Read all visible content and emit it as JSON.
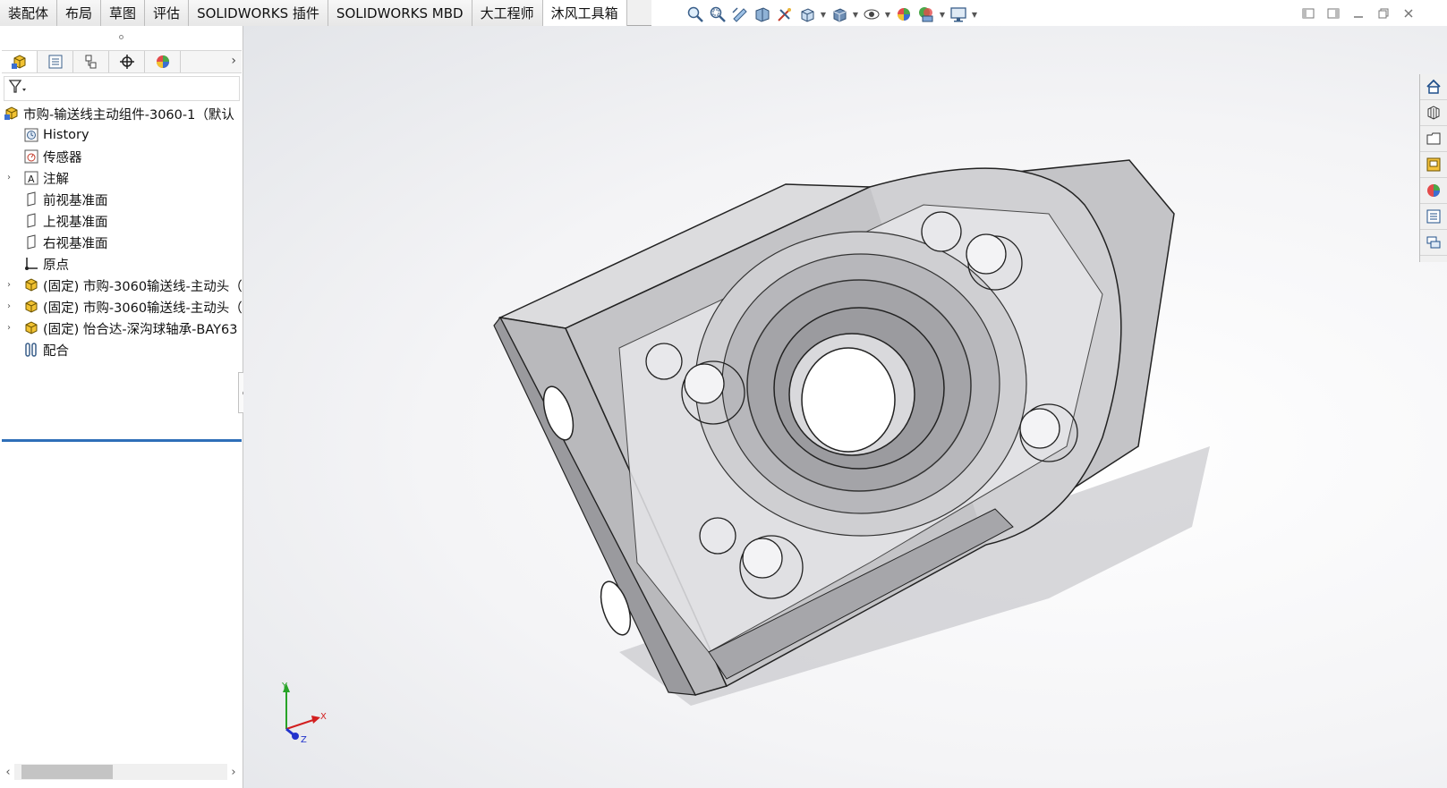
{
  "tabs": [
    {
      "label": "装配体",
      "active": false
    },
    {
      "label": "布局",
      "active": false
    },
    {
      "label": "草图",
      "active": false
    },
    {
      "label": "评估",
      "active": false
    },
    {
      "label": "SOLIDWORKS 插件",
      "active": false
    },
    {
      "label": "SOLIDWORKS MBD",
      "active": false
    },
    {
      "label": "大工程师",
      "active": false
    },
    {
      "label": "沐风工具箱",
      "active": true
    }
  ],
  "view_toolbar": [
    "zoom-to-fit-icon",
    "zoom-to-area-icon",
    "previous-view-icon",
    "section-view-icon",
    "dynamic-annotation-icon",
    "view-orientation-icon",
    "display-style-icon",
    "hide-show-icon",
    "edit-appearance-icon",
    "apply-scene-icon",
    "view-settings-icon"
  ],
  "manager_tabs": [
    "feature-manager-icon",
    "property-manager-icon",
    "configuration-manager-icon",
    "dimxpert-icon",
    "display-manager-icon"
  ],
  "tree": {
    "root": "市购-输送线主动组件-3060-1（默认",
    "items": [
      {
        "label": "History",
        "icon": "history-icon",
        "expand": false
      },
      {
        "label": "传感器",
        "icon": "sensor-icon",
        "expand": false
      },
      {
        "label": "注解",
        "icon": "annotation-icon",
        "expand": true
      },
      {
        "label": "前视基准面",
        "icon": "plane-icon",
        "expand": false
      },
      {
        "label": "上视基准面",
        "icon": "plane-icon",
        "expand": false
      },
      {
        "label": "右视基准面",
        "icon": "plane-icon",
        "expand": false
      },
      {
        "label": "原点",
        "icon": "origin-icon",
        "expand": false
      },
      {
        "label": "(固定) 市购-3060输送线-主动头（",
        "icon": "part-icon",
        "expand": true
      },
      {
        "label": "(固定) 市购-3060输送线-主动头（",
        "icon": "part-icon",
        "expand": true
      },
      {
        "label": "(固定) 怡合达-深沟球轴承-BAY63",
        "icon": "part-icon",
        "expand": true
      },
      {
        "label": "配合",
        "icon": "mates-icon",
        "expand": false
      }
    ]
  },
  "task_pane": [
    "home-icon",
    "design-library-icon",
    "file-explorer-icon",
    "view-palette-icon",
    "appearances-icon",
    "custom-properties-icon",
    "forum-icon"
  ],
  "triad": {
    "x": "X",
    "y": "Y",
    "z": "Z"
  },
  "colors": {
    "selection": "#2f6fb8",
    "axis_x": "#d21f1f",
    "axis_y": "#27a327",
    "axis_z": "#2233cc"
  }
}
